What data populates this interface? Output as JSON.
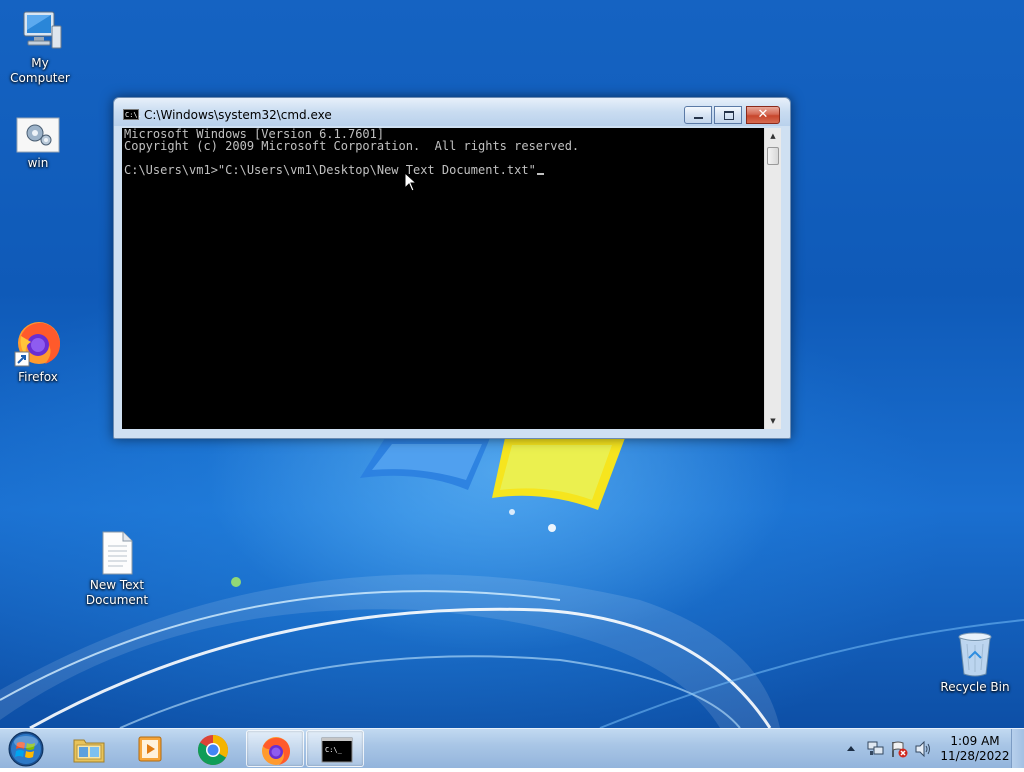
{
  "desktop": {
    "icons": [
      {
        "label": "My Computer",
        "icon": "computer-icon"
      },
      {
        "label": "win",
        "icon": "settings-shortcut-icon"
      },
      {
        "label": "Firefox",
        "icon": "firefox-icon"
      },
      {
        "label": "New Text Document",
        "line1": "New Text",
        "line2": "Document",
        "icon": "text-document-icon"
      },
      {
        "label": "Recycle Bin",
        "icon": "recycle-bin-icon"
      }
    ]
  },
  "cmd_window": {
    "title": "C:\\Windows\\system32\\cmd.exe",
    "icon_text": "C:\\.",
    "console_lines": [
      "Microsoft Windows [Version 6.1.7601]",
      "Copyright (c) 2009 Microsoft Corporation.  All rights reserved.",
      "",
      "C:\\Users\\vm1>\"C:\\Users\\vm1\\Desktop\\New Text Document.txt\""
    ],
    "close_glyph": "✕"
  },
  "taskbar": {
    "items": [
      {
        "name": "windows-explorer",
        "icon": "folder-icon",
        "active": false
      },
      {
        "name": "media-player",
        "icon": "media-player-icon",
        "active": false
      },
      {
        "name": "chrome",
        "icon": "chrome-icon",
        "active": false
      },
      {
        "name": "firefox",
        "icon": "firefox-icon",
        "active": true
      },
      {
        "name": "cmd",
        "icon": "cmd-icon",
        "active": true
      }
    ],
    "cmd_icon_text": "C:\\_",
    "clock": {
      "time": "1:09 AM",
      "date": "11/28/2022"
    }
  },
  "colors": {
    "console_bg": "#000000",
    "console_fg": "#c0c0c0",
    "desktop_blue": "#1563c2"
  }
}
